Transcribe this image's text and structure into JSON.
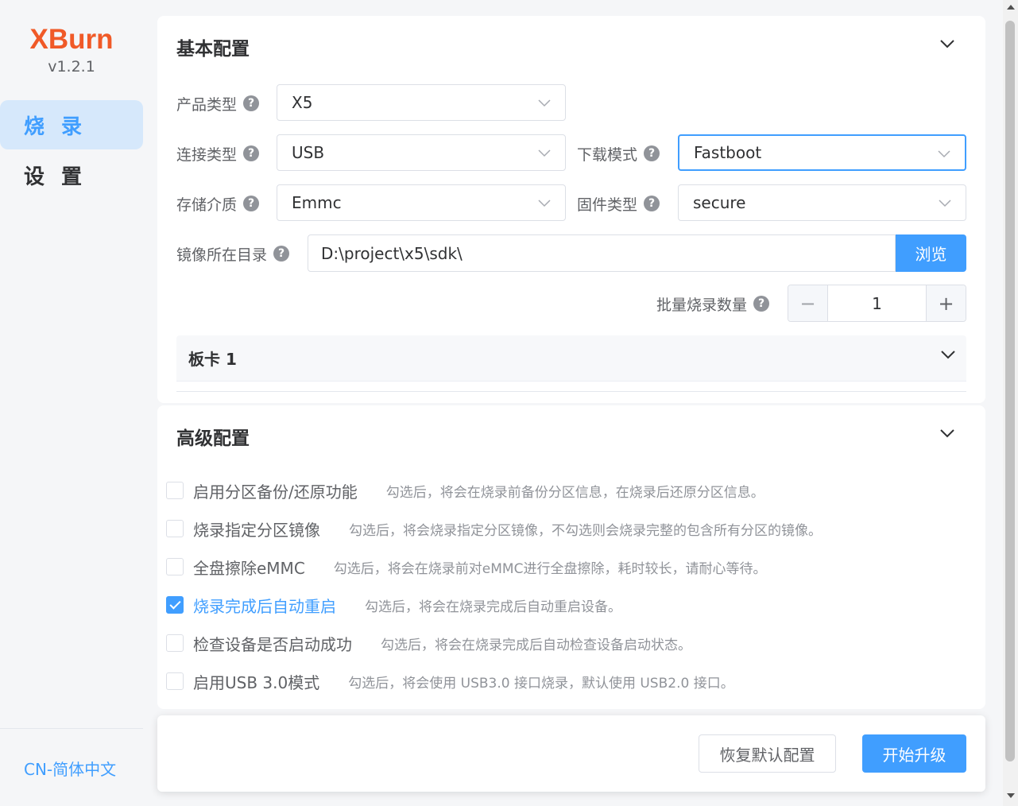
{
  "app": {
    "brand": "XBurn",
    "version": "v1.2.1"
  },
  "sidebar": {
    "items": [
      {
        "label": "烧 录",
        "active": true
      },
      {
        "label": "设 置",
        "active": false
      }
    ],
    "language": "CN-简体中文"
  },
  "basic": {
    "title": "基本配置",
    "product_type": {
      "label": "产品类型",
      "value": "X5"
    },
    "connect_type": {
      "label": "连接类型",
      "value": "USB"
    },
    "download_mode": {
      "label": "下载模式",
      "value": "Fastboot"
    },
    "storage": {
      "label": "存储介质",
      "value": "Emmc"
    },
    "firmware_type": {
      "label": "固件类型",
      "value": "secure"
    },
    "image_dir": {
      "label": "镜像所在目录",
      "value": "D:\\project\\x5\\sdk\\",
      "browse": "浏览"
    },
    "batch": {
      "label": "批量烧录数量",
      "value": "1",
      "minus": "−",
      "plus": "+"
    },
    "board": {
      "title": "板卡 1"
    }
  },
  "advanced": {
    "title": "高级配置",
    "options": [
      {
        "label": "启用分区备份/还原功能",
        "desc": "勾选后，将会在烧录前备份分区信息，在烧录后还原分区信息。",
        "checked": false
      },
      {
        "label": "烧录指定分区镜像",
        "desc": "勾选后，将会烧录指定分区镜像，不勾选则会烧录完整的包含所有分区的镜像。",
        "checked": false
      },
      {
        "label": "全盘擦除eMMC",
        "desc": "勾选后，将会在烧录前对eMMC进行全盘擦除，耗时较长，请耐心等待。",
        "checked": false
      },
      {
        "label": "烧录完成后自动重启",
        "desc": "勾选后，将会在烧录完成后自动重启设备。",
        "checked": true
      },
      {
        "label": "检查设备是否启动成功",
        "desc": "勾选后，将会在烧录完成后自动检查设备启动状态。",
        "checked": false
      },
      {
        "label": "启用USB 3.0模式",
        "desc": "勾选后，将会使用 USB3.0 接口烧录，默认使用 USB2.0 接口。",
        "checked": false
      }
    ]
  },
  "footer": {
    "reset": "恢复默认配置",
    "start": "开始升级"
  },
  "colors": {
    "accent": "#409eff",
    "brand": "#f05a28"
  }
}
